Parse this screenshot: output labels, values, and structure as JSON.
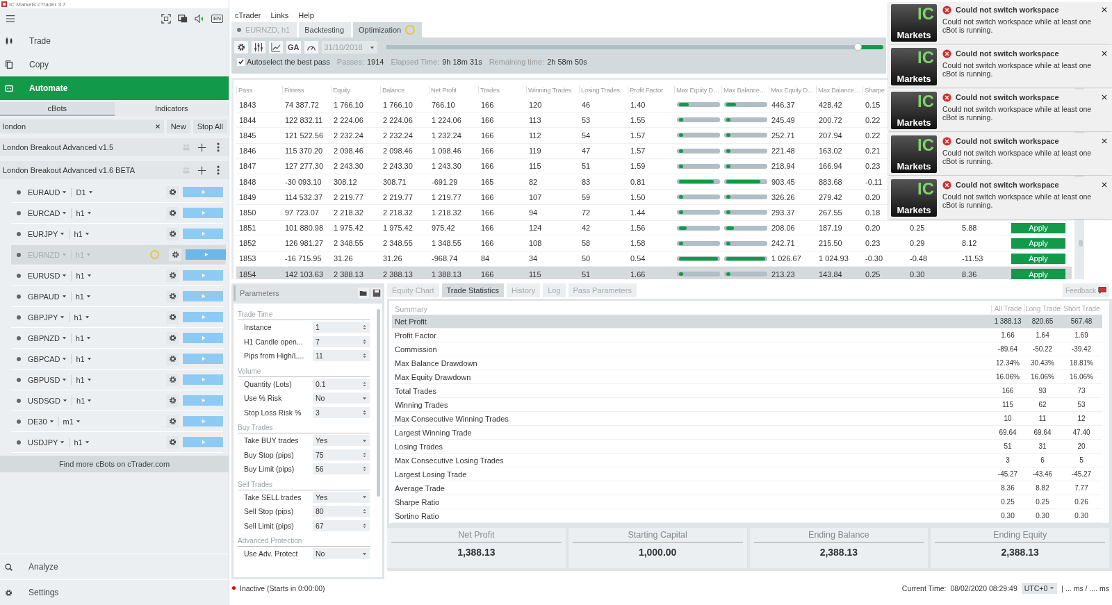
{
  "window": {
    "title": "IC Markets cTrader 3.7"
  },
  "sidebar": {
    "language": "EN",
    "nav": [
      {
        "label": "Trade",
        "selected": false
      },
      {
        "label": "Copy",
        "selected": false
      },
      {
        "label": "Automate",
        "selected": true
      }
    ],
    "tabs": [
      {
        "label": "cBots",
        "selected": true
      },
      {
        "label": "Indicators",
        "selected": false
      }
    ],
    "search": {
      "value": "london"
    },
    "buttons": [
      "New",
      "Stop All"
    ],
    "groups": [
      {
        "name": "London Breakout Advanced v1.5"
      },
      {
        "name": "London Breakout Advanced v1.6 BETA"
      }
    ],
    "instances": [
      {
        "symbol": "EURAUD",
        "timeframe": "D1",
        "selected": false,
        "busy": false
      },
      {
        "symbol": "EURCAD",
        "timeframe": "h1",
        "selected": false,
        "busy": false
      },
      {
        "symbol": "EURJPY",
        "timeframe": "h1",
        "selected": false,
        "busy": false
      },
      {
        "symbol": "EURNZD",
        "timeframe": "h1",
        "selected": true,
        "busy": true
      },
      {
        "symbol": "EURUSD",
        "timeframe": "h1",
        "selected": false,
        "busy": false
      },
      {
        "symbol": "GBPAUD",
        "timeframe": "h1",
        "selected": false,
        "busy": false
      },
      {
        "symbol": "GBPJPY",
        "timeframe": "h1",
        "selected": false,
        "busy": false
      },
      {
        "symbol": "GBPNZD",
        "timeframe": "h1",
        "selected": false,
        "busy": false
      },
      {
        "symbol": "GBPCAD",
        "timeframe": "h1",
        "selected": false,
        "busy": false
      },
      {
        "symbol": "GBPUSD",
        "timeframe": "h1",
        "selected": false,
        "busy": false
      },
      {
        "symbol": "USDSGD",
        "timeframe": "h1",
        "selected": false,
        "busy": false
      },
      {
        "symbol": "DE30",
        "timeframe": "m1",
        "selected": false,
        "busy": false
      },
      {
        "symbol": "USDJPY",
        "timeframe": "h1",
        "selected": false,
        "busy": false
      }
    ],
    "find_more": "Find more cBots on cTrader.com",
    "bottom_nav": [
      {
        "label": "Analyze"
      },
      {
        "label": "Settings"
      }
    ]
  },
  "menu": [
    "cTrader",
    "Links",
    "Help"
  ],
  "doc_tabs": [
    {
      "label": "EURNZD, h1",
      "selected": false,
      "dot": true,
      "busy": false
    },
    {
      "label": "Backtesting",
      "selected": false,
      "dot": false,
      "busy": false
    },
    {
      "label": "Optimization",
      "selected": true,
      "dot": false,
      "busy": true
    }
  ],
  "toolbar": {
    "ga": "GA",
    "date": {
      "value": "31/10/2018",
      "disabled": true
    },
    "progress": {
      "level": 0.95
    },
    "autoselect": {
      "label": "Autoselect the best pass",
      "checked": true
    },
    "stats": [
      {
        "label": "Passes:",
        "value": "1914"
      },
      {
        "label": "Elapsed Time:",
        "value": "9h 18m 31s"
      },
      {
        "label": "Remaining time:",
        "value": "2h 58m 50s"
      }
    ]
  },
  "passes": {
    "columns": [
      "Pass",
      "Fitness",
      "Equity",
      "Balance",
      "Net Profit",
      "Trades",
      "Winning Trades",
      "Losing Trades",
      "Profit Factor",
      "Max Equity D…",
      "Max Balance…",
      "Max Equity D…",
      "Max Balance…",
      "Sharpe"
    ],
    "rows": [
      {
        "cells": [
          "1843",
          "74 387.72",
          "1 766.10",
          "1 766.10",
          "766.10",
          "166",
          "120",
          "46",
          "1.40",
          {
            "level": 0.25
          },
          {
            "level": 0.25
          },
          "446.37",
          "428.42",
          "0.15"
        ],
        "selected": false
      },
      {
        "cells": [
          "1844",
          "122 832.11",
          "2 224.06",
          "2 224.06",
          "1 224.06",
          "166",
          "113",
          "53",
          "1.55",
          {
            "level": 0.1
          },
          {
            "level": 0.1
          },
          "245.49",
          "200.72",
          "0.22"
        ],
        "selected": false
      },
      {
        "cells": [
          "1845",
          "121 522.56",
          "2 232.24",
          "2 232.24",
          "1 232.24",
          "166",
          "112",
          "54",
          "1.57",
          {
            "level": 0.1
          },
          {
            "level": 0.1
          },
          "252.71",
          "207.94",
          "0.22"
        ],
        "selected": false
      },
      {
        "cells": [
          "1846",
          "115 370.20",
          "2 098.46",
          "2 098.46",
          "1 098.46",
          "166",
          "119",
          "47",
          "1.57",
          {
            "level": 0.1
          },
          {
            "level": 0.1
          },
          "221.48",
          "163.02",
          "0.21"
        ],
        "selected": false
      },
      {
        "cells": [
          "1847",
          "127 277.30",
          "2 243.30",
          "2 243.30",
          "1 243.30",
          "166",
          "115",
          "51",
          "1.59",
          {
            "level": 0.1
          },
          {
            "level": 0.1
          },
          "218.94",
          "166.94",
          "0.23"
        ],
        "selected": false
      },
      {
        "cells": [
          "1848",
          "-30 093.10",
          "308.12",
          "308.71",
          "-691.29",
          "165",
          "82",
          "83",
          "0.81",
          {
            "level": 0.9
          },
          {
            "level": 0.88
          },
          "903.45",
          "883.68",
          "-0.11"
        ],
        "selected": false
      },
      {
        "cells": [
          "1849",
          "114 532.37",
          "2 219.77",
          "2 219.77",
          "1 219.77",
          "166",
          "107",
          "59",
          "1.50",
          {
            "level": 0.1
          },
          {
            "level": 0.1
          },
          "326.26",
          "279.42",
          "0.20"
        ],
        "selected": false
      },
      {
        "cells": [
          "1850",
          "97 723.07",
          "2 218.32",
          "2 218.32",
          "1 218.32",
          "166",
          "94",
          "72",
          "1.44",
          {
            "level": 0.1
          },
          {
            "level": 0.1
          },
          "293.37",
          "267.55",
          "0.18"
        ],
        "selected": false
      },
      {
        "cells": [
          "1851",
          "101 880.98",
          "1 975.42",
          "1 975.42",
          "975.42",
          "166",
          "124",
          "42",
          "1.56",
          {
            "level": 0.2
          },
          {
            "level": 0.2
          },
          "208.06",
          "187.19",
          "0.20"
        ],
        "selected": false,
        "extra": [
          "0.25",
          "5.88"
        ],
        "action": "Apply"
      },
      {
        "cells": [
          "1852",
          "126 981.27",
          "2 348.55",
          "2 348.55",
          "1 348.55",
          "166",
          "108",
          "58",
          "1.58",
          {
            "level": 0.1
          },
          {
            "level": 0.1
          },
          "242.71",
          "215.50",
          "0.23"
        ],
        "selected": false,
        "extra": [
          "0.29",
          "8.12"
        ],
        "action": "Apply"
      },
      {
        "cells": [
          "1853",
          "-16 715.95",
          "31.26",
          "31.26",
          "-968.74",
          "84",
          "34",
          "50",
          "0.54",
          {
            "level": 1
          },
          {
            "level": 1
          },
          "1 026.67",
          "1 024.93",
          "-0.30"
        ],
        "selected": false,
        "extra": [
          "-0.48",
          "-11.53"
        ],
        "action": "Apply"
      },
      {
        "cells": [
          "1854",
          "142 103.63",
          "2 388.13",
          "2 388.13",
          "1 388.13",
          "166",
          "115",
          "51",
          "1.66",
          {
            "level": 0.1
          },
          {
            "level": 0.1
          },
          "213.23",
          "143.84",
          "0.25"
        ],
        "selected": true,
        "extra": [
          "0.30",
          "8.36"
        ],
        "action": "Apply"
      }
    ]
  },
  "parameters": {
    "title": "Parameters",
    "groups": [
      {
        "heading": "Trade Time",
        "fields": [
          {
            "label": "Instance",
            "value": "1",
            "kind": "spin"
          },
          {
            "label": "H1 Candle open...",
            "value": "7",
            "kind": "spin"
          },
          {
            "label": "Pips from High/L...",
            "value": "11",
            "kind": "spin"
          }
        ]
      },
      {
        "heading": "Volume",
        "fields": [
          {
            "label": "Quantity (Lots)",
            "value": "0.1",
            "kind": "spin"
          },
          {
            "label": "Use % Risk",
            "value": "No",
            "kind": "select"
          },
          {
            "label": "Stop Loss Risk %",
            "value": "3",
            "kind": "spin"
          }
        ]
      },
      {
        "heading": "Buy Trades",
        "fields": [
          {
            "label": "Take BUY trades",
            "value": "Yes",
            "kind": "select"
          },
          {
            "label": "Buy Stop (pips)",
            "value": "75",
            "kind": "spin"
          },
          {
            "label": "Buy Limit (pips)",
            "value": "56",
            "kind": "spin"
          }
        ]
      },
      {
        "heading": "Sell Trades",
        "fields": [
          {
            "label": "Take SELL trades",
            "value": "Yes",
            "kind": "select"
          },
          {
            "label": "Sell Stop (pips)",
            "value": "80",
            "kind": "spin"
          },
          {
            "label": "Sell Limit (pips)",
            "value": "67",
            "kind": "spin"
          }
        ]
      },
      {
        "heading": "Advanced Protection",
        "fields": [
          {
            "label": "Use Adv. Protect",
            "value": "No",
            "kind": "select"
          }
        ]
      }
    ]
  },
  "result_tabs": [
    {
      "label": "Equity Chart",
      "selected": false
    },
    {
      "label": "Trade Statistics",
      "selected": true
    },
    {
      "label": "History",
      "selected": false
    },
    {
      "label": "Log",
      "selected": false
    },
    {
      "label": "Pass Parameters",
      "selected": false
    }
  ],
  "feedback": "Feedback",
  "statistics": {
    "columns": [
      "Summary",
      "All Trade",
      "Long Trade",
      "Short Trade"
    ],
    "rows": [
      {
        "label": "Net Profit",
        "all": "1 388.13",
        "long": "820.65",
        "short": "567.48",
        "selected": true
      },
      {
        "label": "Profit Factor",
        "all": "1.66",
        "long": "1.64",
        "short": "1.69",
        "selected": false
      },
      {
        "label": "Commission",
        "all": "-89.64",
        "long": "-50.22",
        "short": "-39.42",
        "selected": false
      },
      {
        "label": "Max Balance Drawdown",
        "all": "12.34%",
        "long": "30.43%",
        "short": "18.81%",
        "selected": false
      },
      {
        "label": "Max Equity Drawdown",
        "all": "16.06%",
        "long": "16.06%",
        "short": "16.06%",
        "selected": false
      },
      {
        "label": "Total Trades",
        "all": "166",
        "long": "93",
        "short": "73",
        "selected": false
      },
      {
        "label": "Winning Trades",
        "all": "115",
        "long": "62",
        "short": "53",
        "selected": false
      },
      {
        "label": "Max Consecutive Winning Trades",
        "all": "10",
        "long": "11",
        "short": "12",
        "selected": false
      },
      {
        "label": "Largest Winning Trade",
        "all": "69.64",
        "long": "69.64",
        "short": "47.40",
        "selected": false
      },
      {
        "label": "Losing Trades",
        "all": "51",
        "long": "31",
        "short": "20",
        "selected": false
      },
      {
        "label": "Max Consecutive Losing Trades",
        "all": "3",
        "long": "6",
        "short": "5",
        "selected": false
      },
      {
        "label": "Largest Losing Trade",
        "all": "-45.27",
        "long": "-43.46",
        "short": "-45.27",
        "selected": false
      },
      {
        "label": "Average Trade",
        "all": "8.36",
        "long": "8.82",
        "short": "7.77",
        "selected": false
      },
      {
        "label": "Sharpe Ratio",
        "all": "0.25",
        "long": "0.25",
        "short": "0.26",
        "selected": false
      },
      {
        "label": "Sortino Ratio",
        "all": "0.30",
        "long": "0.30",
        "short": "0.30",
        "selected": false
      }
    ]
  },
  "summary_cards": [
    {
      "title": "Net Profit",
      "value": "1,388.13"
    },
    {
      "title": "Starting Capital",
      "value": "1,000.00"
    },
    {
      "title": "Ending Balance",
      "value": "2,388.13"
    },
    {
      "title": "Ending Equity",
      "value": "2,388.13"
    }
  ],
  "status_bar": {
    "state": "Inactive (Starts in 0:00:00)",
    "time_label": "Current Time:",
    "time": "08/02/2020 08:29:49",
    "timezone": "UTC+0",
    "latency": "| ... ms / .... ms"
  },
  "notifications": [
    {
      "logo_top": "IC",
      "logo_bottom": "Markets",
      "title": "Could not switch workspace",
      "message": "Could not switch workspace while at least one cBot is running."
    },
    {
      "logo_top": "IC",
      "logo_bottom": "Markets",
      "title": "Could not switch workspace",
      "message": "Could not switch workspace while at least one cBot is running."
    },
    {
      "logo_top": "IC",
      "logo_bottom": "Markets",
      "title": "Could not switch workspace",
      "message": "Could not switch workspace while at least one cBot is running."
    },
    {
      "logo_top": "IC",
      "logo_bottom": "Markets",
      "title": "Could not switch workspace",
      "message": "Could not switch workspace while at least one cBot is running."
    },
    {
      "logo_top": "IC",
      "logo_bottom": "Markets",
      "title": "Could not switch workspace",
      "message": "Could not switch workspace while at least one cBot is running."
    }
  ]
}
